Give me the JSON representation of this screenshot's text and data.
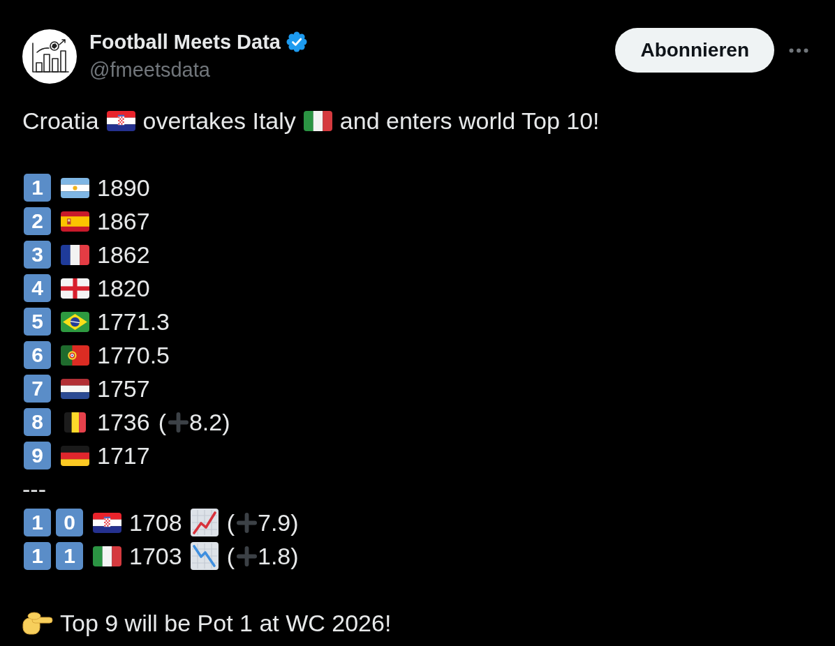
{
  "author": {
    "name": "Football Meets Data",
    "verified": true,
    "handle": "@fmeetsdata"
  },
  "subscribe_button": "Abonnieren",
  "headline": [
    {
      "text": "Croatia",
      "flag": {
        "kind": "croatia"
      }
    },
    {
      "text": "overtakes Italy",
      "flag": {
        "kind": "italy"
      }
    },
    {
      "text": "and enters world Top 10!"
    }
  ],
  "rankings": [
    {
      "keycaps": [
        "1"
      ],
      "flag": {
        "kind": "argentina"
      },
      "rating": "1890"
    },
    {
      "keycaps": [
        "2"
      ],
      "flag": {
        "kind": "spain"
      },
      "rating": "1867"
    },
    {
      "keycaps": [
        "3"
      ],
      "flag": {
        "kind": "france"
      },
      "rating": "1862"
    },
    {
      "keycaps": [
        "4"
      ],
      "flag": {
        "kind": "england"
      },
      "rating": "1820"
    },
    {
      "keycaps": [
        "5"
      ],
      "flag": {
        "kind": "brazil"
      },
      "rating": "1771.3"
    },
    {
      "keycaps": [
        "6"
      ],
      "flag": {
        "kind": "portugal"
      },
      "rating": "1770.5"
    },
    {
      "keycaps": [
        "7"
      ],
      "flag": {
        "kind": "netherlands"
      },
      "rating": "1757"
    },
    {
      "keycaps": [
        "8"
      ],
      "flag": {
        "kind": "belgium"
      },
      "rating": "1736",
      "change": {
        "open": "(",
        "value": "8.2)"
      }
    },
    {
      "keycaps": [
        "9"
      ],
      "flag": {
        "kind": "germany"
      },
      "rating": "1717"
    }
  ],
  "separator": "---",
  "rankings_below": [
    {
      "keycaps": [
        "1",
        "0"
      ],
      "flag": {
        "kind": "croatia"
      },
      "rating": "1708",
      "trend": {
        "kind": "up"
      },
      "change": {
        "open": "(",
        "value": "7.9)"
      }
    },
    {
      "keycaps": [
        "1",
        "1"
      ],
      "flag": {
        "kind": "italy"
      },
      "rating": "1703",
      "trend": {
        "kind": "down"
      },
      "change": {
        "open": "(",
        "value": "1.8)"
      }
    }
  ],
  "footer": {
    "text": "Top 9 will be Pot 1 at WC 2026!"
  }
}
